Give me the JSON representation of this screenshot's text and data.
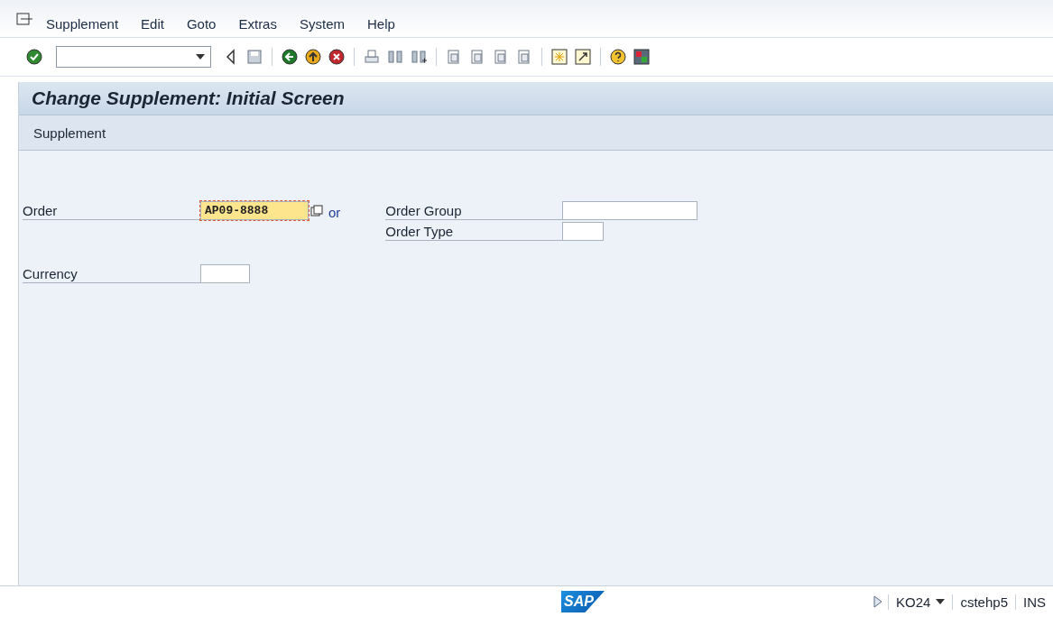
{
  "menu": [
    {
      "label": "Supplement"
    },
    {
      "label": "Edit"
    },
    {
      "label": "Goto"
    },
    {
      "label": "Extras"
    },
    {
      "label": "System"
    },
    {
      "label": "Help"
    }
  ],
  "title": "Change Supplement: Initial Screen",
  "app_toolbar": [
    "Supplement"
  ],
  "left_fields": [
    {
      "label": "Order",
      "value": "AP09-8888",
      "focused": true,
      "or_text": "or"
    },
    {
      "label": "Currency",
      "focused": false
    }
  ],
  "right_fields": [
    {
      "label": "Order Group"
    },
    {
      "label": "Order Type"
    }
  ],
  "status_bar": {
    "logo": "SAP",
    "transaction": "KO24",
    "server": "cstehp5",
    "mode": "INS"
  }
}
